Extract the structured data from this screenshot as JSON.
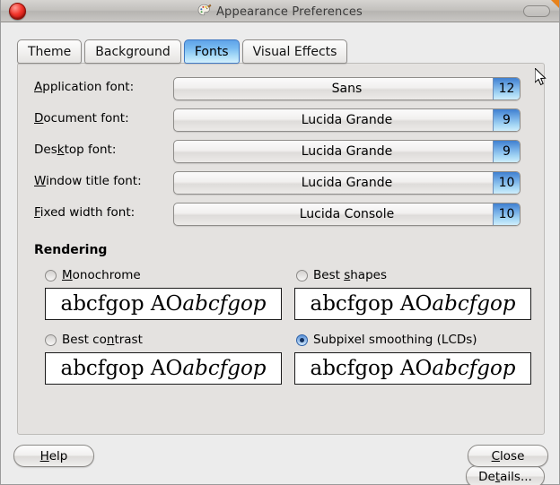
{
  "window": {
    "title": "Appearance Preferences",
    "icon": "palette-icon",
    "close_button": "close-window-button",
    "maximize_button": "maximize-window-button"
  },
  "tabs": [
    {
      "label": "Theme",
      "selected": false
    },
    {
      "label": "Background",
      "selected": false
    },
    {
      "label": "Fonts",
      "selected": true
    },
    {
      "label": "Visual Effects",
      "selected": false
    }
  ],
  "fonts": {
    "rows": [
      {
        "label_pre": "",
        "label_mn": "A",
        "label_post": "pplication font:",
        "value": "Sans",
        "size": "12"
      },
      {
        "label_pre": "",
        "label_mn": "D",
        "label_post": "ocument font:",
        "value": "Lucida Grande",
        "size": "9"
      },
      {
        "label_pre": "Des",
        "label_mn": "k",
        "label_post": "top font:",
        "value": "Lucida Grande",
        "size": "9"
      },
      {
        "label_pre": "",
        "label_mn": "W",
        "label_post": "indow title font:",
        "value": "Lucida Grande",
        "size": "10"
      },
      {
        "label_pre": "",
        "label_mn": "F",
        "label_post": "ixed width font:",
        "value": "Lucida Console",
        "size": "10"
      }
    ]
  },
  "rendering": {
    "title": "Rendering",
    "sample_roman": "abcfgop AO ",
    "sample_italic": "abcfgop",
    "options": [
      {
        "pre": "",
        "mn": "M",
        "post": "onochrome",
        "checked": false
      },
      {
        "pre": "Best ",
        "mn": "s",
        "post": "hapes",
        "checked": false
      },
      {
        "pre": "Best co",
        "mn": "n",
        "post": "trast",
        "checked": false
      },
      {
        "pre": "Subpixel smoothing (LCDs)",
        "mn": "",
        "post": "",
        "checked": true
      }
    ],
    "details_pre": "De",
    "details_mn": "t",
    "details_post": "ails..."
  },
  "footer": {
    "help_pre": "",
    "help_mn": "H",
    "help_post": "elp",
    "close_pre": "",
    "close_mn": "C",
    "close_post": "lose"
  },
  "colors": {
    "accent_blue": "#5fa3e8",
    "window_bg": "#ececec",
    "panel_bg": "#e4e2e0",
    "close_red": "#f2352c",
    "corner_orange": "#e8821b"
  }
}
